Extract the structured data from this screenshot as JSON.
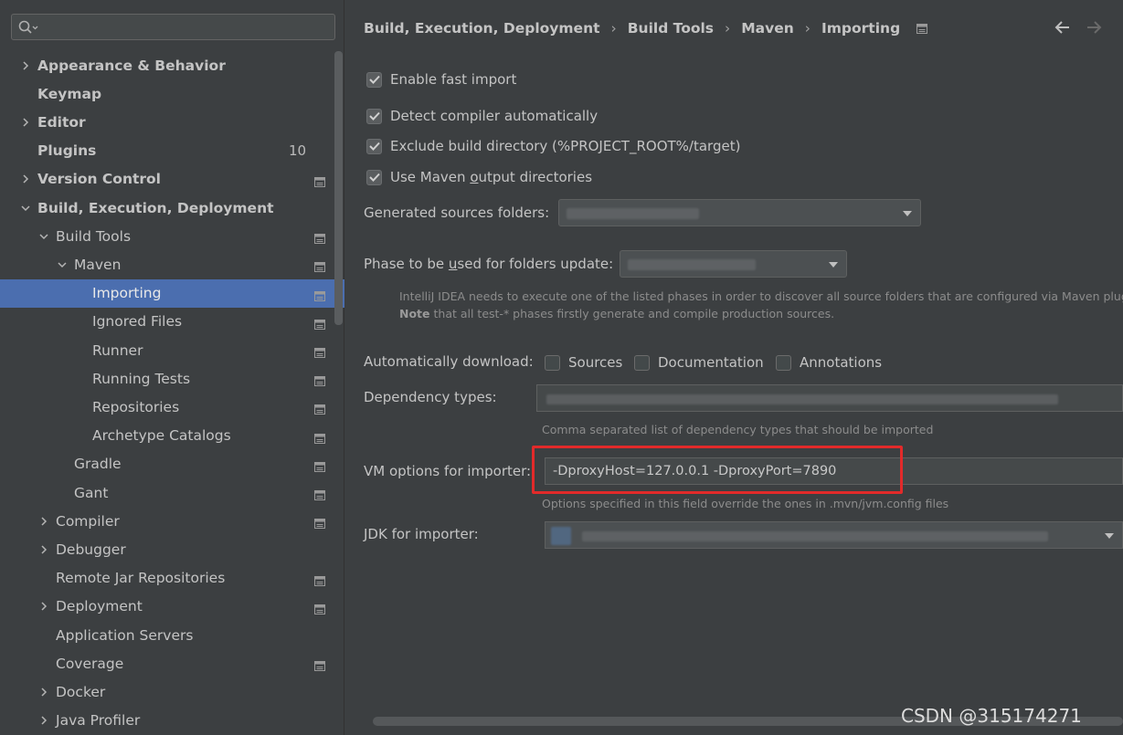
{
  "search": {
    "placeholder": "",
    "value": ""
  },
  "sidebar": {
    "items": [
      {
        "label": "Appearance & Behavior",
        "bold": true,
        "chevron": "right",
        "indent": 0,
        "badge": "",
        "proj": false
      },
      {
        "label": "Keymap",
        "bold": true,
        "chevron": "",
        "indent": 0,
        "badge": "",
        "proj": false
      },
      {
        "label": "Editor",
        "bold": true,
        "chevron": "right",
        "indent": 0,
        "badge": "",
        "proj": false
      },
      {
        "label": "Plugins",
        "bold": true,
        "chevron": "",
        "indent": 0,
        "badge": "10",
        "proj": false
      },
      {
        "label": "Version Control",
        "bold": true,
        "chevron": "right",
        "indent": 0,
        "badge": "",
        "proj": true
      },
      {
        "label": "Build, Execution, Deployment",
        "bold": true,
        "chevron": "down",
        "indent": 0,
        "badge": "",
        "proj": false
      },
      {
        "label": "Build Tools",
        "bold": false,
        "chevron": "down",
        "indent": 1,
        "badge": "",
        "proj": true
      },
      {
        "label": "Maven",
        "bold": false,
        "chevron": "down",
        "indent": 2,
        "badge": "",
        "proj": true
      },
      {
        "label": "Importing",
        "bold": false,
        "chevron": "",
        "indent": 3,
        "badge": "",
        "proj": true,
        "selected": true
      },
      {
        "label": "Ignored Files",
        "bold": false,
        "chevron": "",
        "indent": 3,
        "badge": "",
        "proj": true
      },
      {
        "label": "Runner",
        "bold": false,
        "chevron": "",
        "indent": 3,
        "badge": "",
        "proj": true
      },
      {
        "label": "Running Tests",
        "bold": false,
        "chevron": "",
        "indent": 3,
        "badge": "",
        "proj": true
      },
      {
        "label": "Repositories",
        "bold": false,
        "chevron": "",
        "indent": 3,
        "badge": "",
        "proj": true
      },
      {
        "label": "Archetype Catalogs",
        "bold": false,
        "chevron": "",
        "indent": 3,
        "badge": "",
        "proj": true
      },
      {
        "label": "Gradle",
        "bold": false,
        "chevron": "",
        "indent": 2,
        "badge": "",
        "proj": true
      },
      {
        "label": "Gant",
        "bold": false,
        "chevron": "",
        "indent": 2,
        "badge": "",
        "proj": true
      },
      {
        "label": "Compiler",
        "bold": false,
        "chevron": "right",
        "indent": 1,
        "badge": "",
        "proj": true
      },
      {
        "label": "Debugger",
        "bold": false,
        "chevron": "right",
        "indent": 1,
        "badge": "",
        "proj": false
      },
      {
        "label": "Remote Jar Repositories",
        "bold": false,
        "chevron": "",
        "indent": 1,
        "badge": "",
        "proj": true
      },
      {
        "label": "Deployment",
        "bold": false,
        "chevron": "right",
        "indent": 1,
        "badge": "",
        "proj": true
      },
      {
        "label": "Application Servers",
        "bold": false,
        "chevron": "",
        "indent": 1,
        "badge": "",
        "proj": false
      },
      {
        "label": "Coverage",
        "bold": false,
        "chevron": "",
        "indent": 1,
        "badge": "",
        "proj": true
      },
      {
        "label": "Docker",
        "bold": false,
        "chevron": "right",
        "indent": 1,
        "badge": "",
        "proj": false
      },
      {
        "label": "Java Profiler",
        "bold": false,
        "chevron": "right",
        "indent": 1,
        "badge": "",
        "proj": false
      }
    ]
  },
  "breadcrumb": {
    "items": [
      "Build, Execution, Deployment",
      "Build Tools",
      "Maven",
      "Importing"
    ],
    "separator": "›"
  },
  "options": {
    "enable_fast_import": "Enable fast import",
    "detect_compiler": "Detect compiler automatically",
    "exclude_build_dir": "Exclude build directory (%PROJECT_ROOT%/target)",
    "use_maven_output_pre": "Use Maven ",
    "use_maven_output_u": "o",
    "use_maven_output_post": "utput directories"
  },
  "generated_sources": {
    "label": "Generated sources folders:"
  },
  "phase": {
    "label_pre": "Phase to be ",
    "label_u": "u",
    "label_post": "sed for folders update:",
    "hint_line1": "IntelliJ IDEA needs to execute one of the listed phases in order to discover all source folders that are configured via Maven plugins.",
    "hint_note": "Note",
    "hint_line2": " that all test-* phases firstly generate and compile production sources."
  },
  "auto_download": {
    "label": "Automatically download:",
    "sources": "Sources",
    "documentation": "Documentation",
    "annotations": "Annotations"
  },
  "dependency_types": {
    "label": "Dependency types:",
    "hint": "Comma separated list of dependency types that should be imported"
  },
  "vm_options": {
    "label": "VM options for importer:",
    "value": "-DproxyHost=127.0.0.1 -DproxyPort=7890",
    "hint": "Options specified in this field override the ones in .mvn/jvm.config files"
  },
  "jdk": {
    "label": "JDK for importer:"
  },
  "watermark": "CSDN @315174271",
  "colors": {
    "selection": "#4b6eaf",
    "highlight": "#e22a2a",
    "background": "#3c3f41"
  }
}
